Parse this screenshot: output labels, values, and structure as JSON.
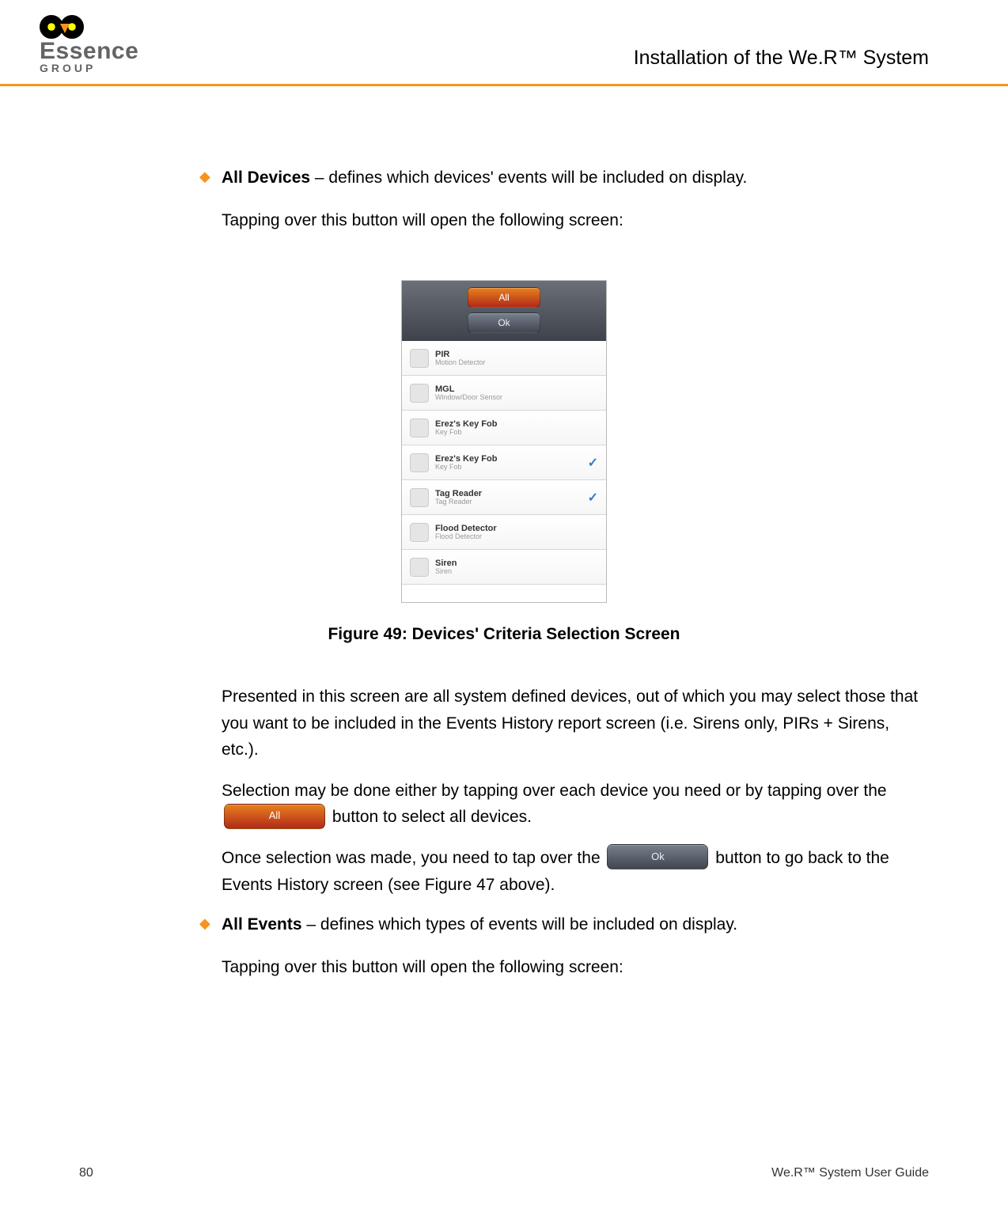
{
  "header": {
    "logo_text": "Essence",
    "logo_sub": "GROUP",
    "title": "Installation of the We.R™ System"
  },
  "bullet1": {
    "label": "All Devices",
    "desc": " – defines which devices' events will be included on display.",
    "sub": "Tapping over this button will open the following screen:"
  },
  "screenshot": {
    "btn_all": "All",
    "btn_ok": "Ok",
    "rows": [
      {
        "title": "PIR",
        "sub": "Motion Detector",
        "checked": false
      },
      {
        "title": "MGL",
        "sub": "Window/Door Sensor",
        "checked": false
      },
      {
        "title": "Erez's Key Fob",
        "sub": "Key Fob",
        "checked": false
      },
      {
        "title": "Erez's Key Fob",
        "sub": "Key Fob",
        "checked": true
      },
      {
        "title": "Tag Reader",
        "sub": "Tag Reader",
        "checked": true
      },
      {
        "title": "Flood Detector",
        "sub": "Flood Detector",
        "checked": false
      },
      {
        "title": "Siren",
        "sub": "Siren",
        "checked": false
      }
    ]
  },
  "figure_caption": "Figure 49: Devices' Criteria Selection Screen",
  "para1": "Presented in this screen are all system defined devices, out of which you may select those that you want to be included in the Events History report screen (i.e. Sirens only, PIRs + Sirens, etc.).",
  "para2a": "Selection may be done either by tapping over each device you need or by tapping over the ",
  "para2b": " button to select all devices.",
  "para3a": "Once selection was made, you need to tap over the ",
  "para3b": " button to go back to the Events History screen (see Figure 47 above).",
  "inline_all": "All",
  "inline_ok": "Ok",
  "bullet2": {
    "label": "All Events",
    "desc": " – defines which types of events will be included on display.",
    "sub": "Tapping over this button will open the following screen:"
  },
  "footer": {
    "page": "80",
    "guide": "We.R™ System User Guide"
  }
}
